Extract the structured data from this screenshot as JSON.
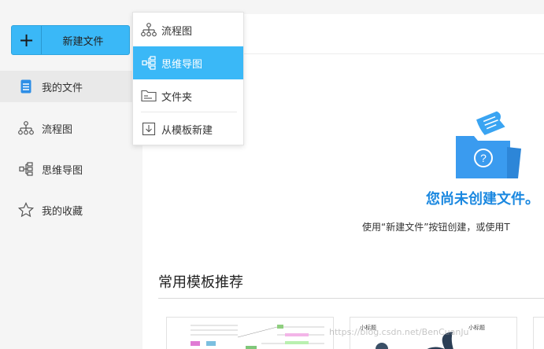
{
  "sidebar": {
    "new_button_label": "新建文件",
    "items": [
      {
        "label": "我的文件"
      },
      {
        "label": "流程图"
      },
      {
        "label": "思维导图"
      },
      {
        "label": "我的收藏"
      }
    ]
  },
  "dropdown": {
    "items": [
      {
        "label": "流程图"
      },
      {
        "label": "思维导图"
      },
      {
        "label": "文件夹"
      },
      {
        "label": "从模板新建"
      }
    ]
  },
  "empty_state": {
    "title": "您尚未创建文件。",
    "description": "使用“新建文件”按钮创建，或使用T"
  },
  "templates": {
    "title": "常用模板推荐",
    "cards": [
      {
        "snippet": "小标题"
      },
      {
        "snippet": "小标题"
      }
    ]
  },
  "watermark": "https://blog.csdn.net/BenCuanJu",
  "colors": {
    "accent": "#3ab8f7",
    "title_blue": "#1b88e0",
    "folder": "#3a9bef"
  }
}
